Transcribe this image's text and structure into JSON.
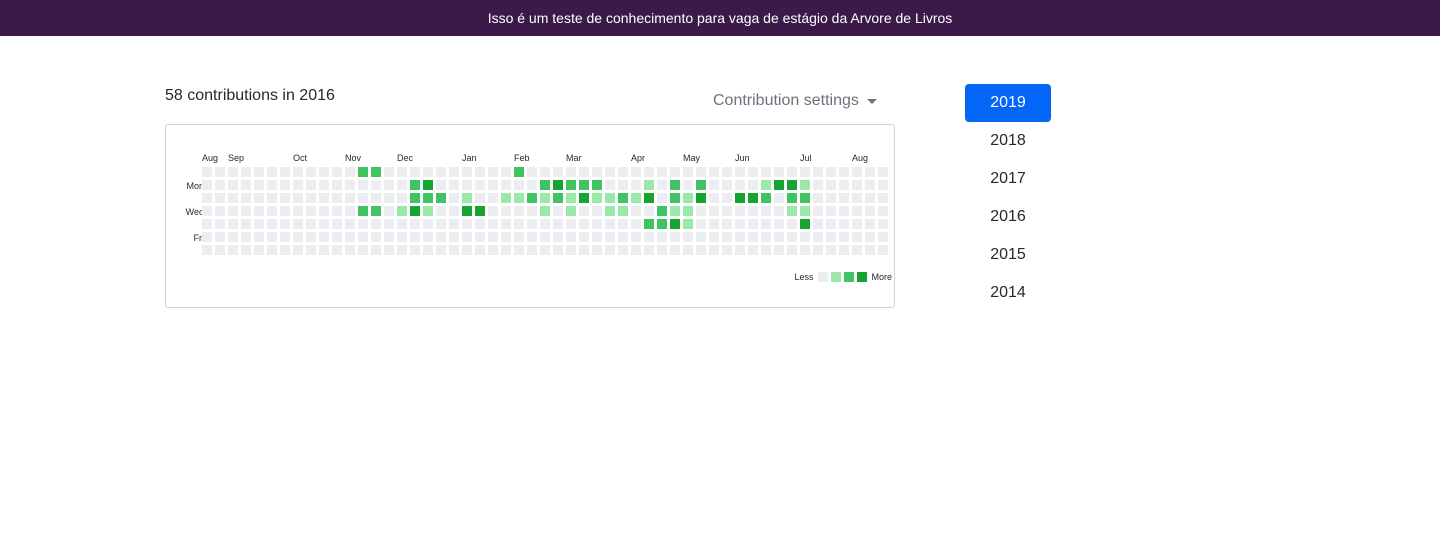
{
  "banner": {
    "text": "Isso é um teste de conhecimento para vaga de estágio da Arvore de Livros"
  },
  "contributions": {
    "title": "58 contributions in 2016",
    "settings_label": "Contribution settings",
    "month_labels": [
      "Aug",
      "Sep",
      "Oct",
      "Nov",
      "Dec",
      "Jan",
      "Feb",
      "Mar",
      "Apr",
      "May",
      "Jun",
      "Jul",
      "Aug"
    ],
    "day_labels": [
      "Mon",
      "Wed",
      "Fri"
    ],
    "legend": {
      "less": "Less",
      "more": "More"
    },
    "colors": [
      "#ebedf0",
      "#9be9a8",
      "#40c463",
      "#13a52f"
    ],
    "grid": [
      "00000000000022000000000020000000000000000000000000000",
      "00000000000000002300000000232220001020200001331000000",
      "00000000000000002220100112121311213021300332022000000",
      "00000000000022013100330000101001100211000000011000000",
      "00000000000000000000000000000000002231000000003000000",
      "00000000000000000000000000000000000000000000000000000",
      "00000000000000000000000000000000000000000000000000000"
    ]
  },
  "years": {
    "items": [
      "2019",
      "2018",
      "2017",
      "2016",
      "2015",
      "2014"
    ],
    "active": "2019"
  }
}
